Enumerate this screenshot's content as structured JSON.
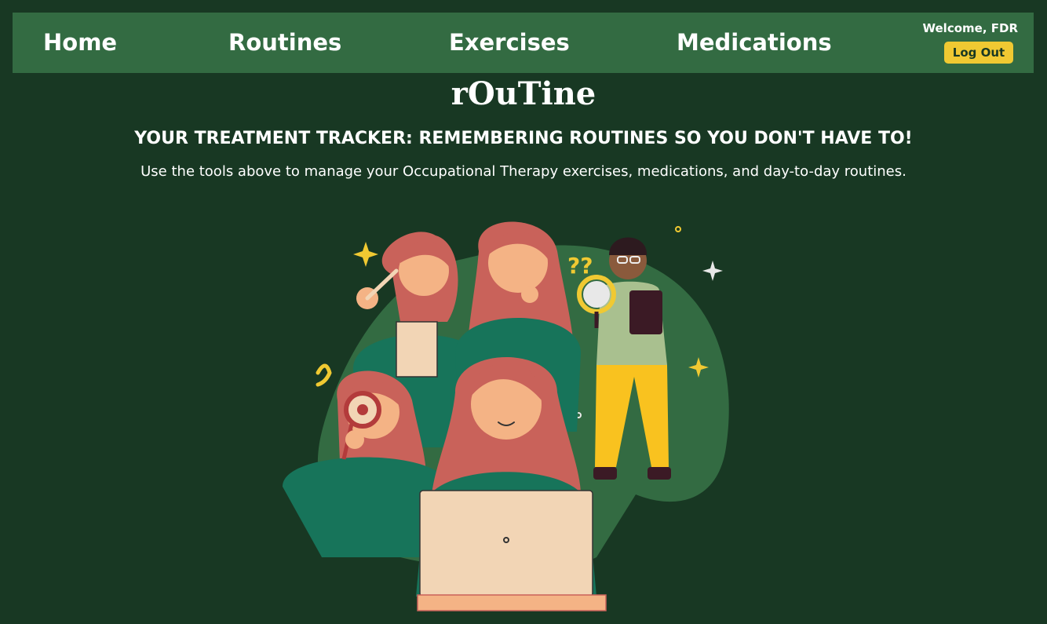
{
  "nav": {
    "home": "Home",
    "routines": "Routines",
    "exercises": "Exercises",
    "medications": "Medications"
  },
  "user": {
    "welcome": "Welcome, FDR",
    "logout_label": "Log Out"
  },
  "hero": {
    "logo": "rOuTine",
    "tagline": "YOUR TREATMENT TRACKER: REMEMBERING ROUTINES SO YOU DON'T HAVE TO!",
    "description": "Use the tools above to manage your Occupational Therapy exercises, medications, and day-to-day routines."
  },
  "colors": {
    "background": "#183823",
    "navbar": "#336b42",
    "accent": "#f0c932",
    "text": "#ffffff"
  },
  "illustration": {
    "icon": "people-researching-illustration"
  }
}
